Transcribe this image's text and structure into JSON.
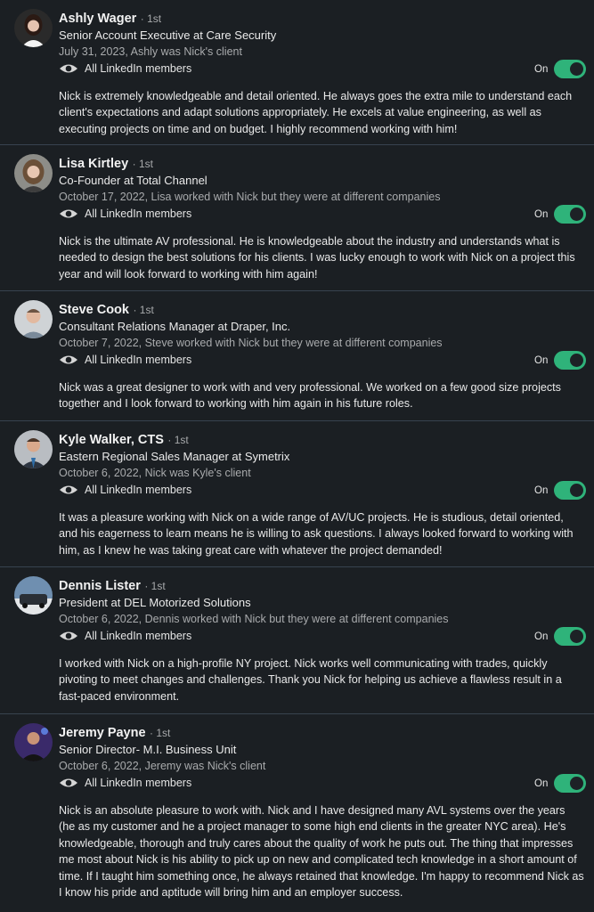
{
  "visibility_label": "All LinkedIn members",
  "toggle_label": "On",
  "recommendations": [
    {
      "name": "Ashly Wager",
      "degree": "· 1st",
      "title": "Senior Account Executive at Care Security",
      "relationship": "July 31, 2023, Ashly was Nick's client",
      "text": "Nick is extremely knowledgeable and detail oriented. He always goes the extra mile to understand each client's expectations and adapt solutions appropriately. He excels at value engineering, as well as executing projects on time and on budget. I highly recommend working with him!",
      "avatar_bg": "#2a2a2a"
    },
    {
      "name": "Lisa Kirtley",
      "degree": "· 1st",
      "title": "Co-Founder at Total Channel",
      "relationship": "October 17, 2022, Lisa worked with Nick but they were at different companies",
      "text": "Nick is the ultimate AV professional. He is knowledgeable about the industry and understands what is needed to design the best solutions for his clients. I was lucky enough to work with Nick on a project this year and will look forward to working with him again!",
      "avatar_bg": "#8d8d88"
    },
    {
      "name": "Steve Cook",
      "degree": "· 1st",
      "title": "Consultant Relations Manager at Draper, Inc.",
      "relationship": "October 7, 2022, Steve worked with Nick but they were at different companies",
      "text": "Nick was a great designer to work with and very professional. We worked on a few good size projects together and I look forward to working with him again in his future roles.",
      "avatar_bg": "#cfd3d6"
    },
    {
      "name": "Kyle Walker, CTS",
      "degree": "· 1st",
      "title": "Eastern Regional Sales Manager at Symetrix",
      "relationship": "October 6, 2022, Nick was Kyle's client",
      "text": "It was a pleasure working with Nick on a wide range of AV/UC projects. He is studious, detail oriented, and his eagerness to learn means he is willing to ask questions. I always looked forward to working with him, as I knew he was taking great care with whatever the project demanded!",
      "avatar_bg": "#b9bdc2"
    },
    {
      "name": "Dennis Lister",
      "degree": "· 1st",
      "title": "President at DEL Motorized Solutions",
      "relationship": "October 6, 2022, Dennis worked with Nick but they were at different companies",
      "text": "I worked with Nick on a high-profile NY project. Nick works well communicating with trades, quickly pivoting to meet changes and challenges. Thank you Nick for helping us achieve a flawless result in a fast-paced environment.",
      "avatar_bg": "#6f8fb0"
    },
    {
      "name": "Jeremy Payne",
      "degree": "· 1st",
      "title": "Senior Director- M.I. Business Unit",
      "relationship": "October 6, 2022, Jeremy was Nick's client",
      "text": "Nick is an absolute pleasure to work with. Nick and I have designed many AVL systems over the years (he as my customer and he a project manager to some high end clients in the greater NYC area). He's knowledgeable, thorough and truly cares about the quality of work he puts out. The thing that impresses me most about Nick is his ability to pick up on new and complicated tech knowledge in a short amount of time. If I taught him something once, he always retained that knowledge. I'm happy to recommend Nick as I know his pride and aptitude will bring him and an employer success.",
      "avatar_bg": "#3a2a6a"
    }
  ]
}
